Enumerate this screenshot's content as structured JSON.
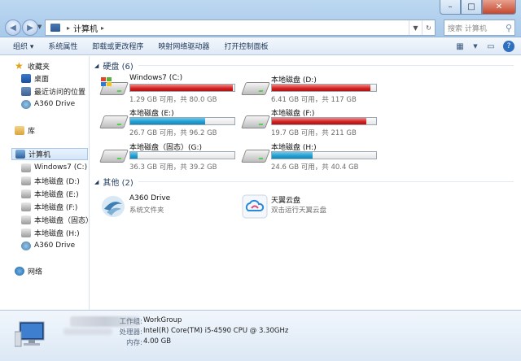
{
  "window": {
    "path": "计算机",
    "search_placeholder": "搜索 计算机"
  },
  "toolbar": {
    "organize": "组织 ▾",
    "system_properties": "系统属性",
    "uninstall": "卸载或更改程序",
    "map_drive": "映射网络驱动器",
    "control_panel": "打开控制面板"
  },
  "sidebar": {
    "favorites": "收藏夹",
    "desktop": "桌面",
    "recent": "最近访问的位置",
    "a360_fav": "A360 Drive",
    "libraries": "库",
    "computer": "计算机",
    "drives": [
      "Windows7 (C:)",
      "本地磁盘 (D:)",
      "本地磁盘 (E:)",
      "本地磁盘 (F:)",
      "本地磁盘（固态）",
      "本地磁盘 (H:)"
    ],
    "a360": "A360 Drive",
    "network": "网络"
  },
  "hard_disks": {
    "header": "硬盘 (6)",
    "drives": [
      {
        "name": "Windows7 (C:)",
        "info": "1.29 GB 可用，共 80.0 GB",
        "used_fraction": 0.984,
        "color": "red"
      },
      {
        "name": "本地磁盘 (D:)",
        "info": "6.41 GB 可用，共 117 GB",
        "used_fraction": 0.945,
        "color": "red"
      },
      {
        "name": "本地磁盘 (E:)",
        "info": "26.7 GB 可用，共 96.2 GB",
        "used_fraction": 0.722,
        "color": "blue"
      },
      {
        "name": "本地磁盘 (F:)",
        "info": "19.7 GB 可用，共 211 GB",
        "used_fraction": 0.907,
        "color": "red"
      },
      {
        "name": "本地磁盘（固态）(G:)",
        "info": "36.3 GB 可用，共 39.2 GB",
        "used_fraction": 0.074,
        "color": "blue"
      },
      {
        "name": "本地磁盘 (H:)",
        "info": "24.6 GB 可用，共 40.4 GB",
        "used_fraction": 0.391,
        "color": "blue"
      }
    ]
  },
  "other_devices": {
    "header": "其他 (2)",
    "items": [
      {
        "name": "A360 Drive",
        "sub": "系统文件夹"
      },
      {
        "name": "天翼云盘",
        "sub": "双击运行天翼云盘"
      }
    ]
  },
  "details": {
    "workgroup_label": "工作组:",
    "workgroup_value": "WorkGroup",
    "cpu_label": "处理器:",
    "cpu_value": "Intel(R) Core(TM) i5-4590 CPU @ 3.30GHz",
    "ram_label": "内存:",
    "ram_value": "4.00 GB"
  }
}
